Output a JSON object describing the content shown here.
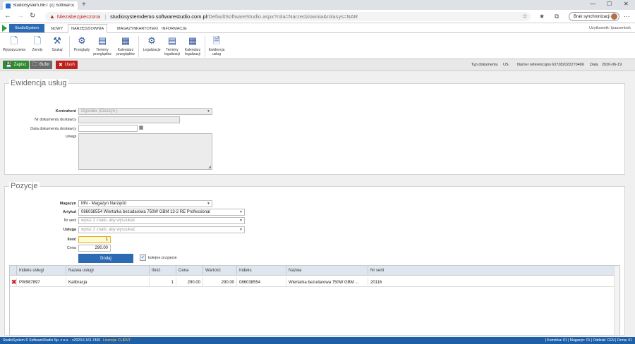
{
  "browser": {
    "tab_title": "StudioSystem.NET (c) SoftwareSt",
    "insecure_label": "Niezabezpieczona",
    "url_host": "studiosystemdemo.softwarestudio.com.pl",
    "url_path": "/DefaultSoftwareStudio.aspx?rola=Narzedziownia&rolasys=NAR",
    "sync_button": "Brak synchronizacji"
  },
  "app_menu": {
    "app_button": "StudioSystem",
    "tabs": [
      "NOWY",
      "NARZĘDZIOWNIA",
      "MAGAZYN",
      "KARTOTEKI",
      "INFORMACJE"
    ],
    "active_tab": "NARZĘDZIOWNIA",
    "logged_user": "Użytkownik: Ipaszenbek"
  },
  "ribbon": {
    "buttons": [
      "Wypożyczenia",
      "Zwroty",
      "Szukaj",
      "Przeglądy",
      "Terminy przeglądów",
      "Kalendarz przeglądów",
      "Legalizacje",
      "Terminy legalizacji",
      "Kalendarz legalizacji",
      "Ewidencja usług"
    ]
  },
  "actions": {
    "save": "Zapisz",
    "buffer": "Bufor",
    "delete": "Usuń"
  },
  "doc_info": {
    "type_label": "Typ dokumentu",
    "type_value": "US",
    "ref_label": "Numer referencyjny",
    "ref_value": "637282022270406",
    "date_label": "Data",
    "date_value": "2020-06-19"
  },
  "ewidencja": {
    "title": "Ewidencja usług",
    "kontrahent_label": "Kontrahent",
    "kontrahent_value": "Ogrodex (Cieszyn )",
    "nr_dok_label": "Nr dokumentu dostawcy",
    "nr_dok_value": "",
    "data_dok_label": "Data dokumentu dostawcy",
    "data_dok_value": "",
    "uwagi_label": "Uwagi"
  },
  "pozycje": {
    "title": "Pozycje",
    "magazyn_label": "Magazyn",
    "magazyn_value": "MN - Magazyn Narzędzi",
    "artykul_label": "Artykuł",
    "artykul_value": "086038554 Wiertarka bezudarowa 750W GBM 13-2 RE Professional",
    "nr_serii_label": "Nr serii",
    "nr_serii_placeholder": "wpisz 2 znaki, aby wyszukać",
    "usluga_label": "Usługa",
    "usluga_placeholder": "wpisz 2 znaki, aby wyszukać",
    "ilosc_label": "Ilość",
    "ilosc_value": "1",
    "cena_label": "Cena",
    "cena_value": "290.00",
    "add_button": "Dodaj",
    "kolejne_label": "kolejne przyjęcie"
  },
  "grid": {
    "columns": [
      "Indeks usługi",
      "Nazwa usługi",
      "Ilość",
      "Cena",
      "Wartość",
      "Indeks",
      "Nazwa",
      "Nr serii"
    ],
    "rows": [
      [
        "PW987897",
        "Kalibracja",
        "1",
        "290.00",
        "290.00",
        "086038554",
        "Wiertarka bezudarowa 750W GBM ...",
        "20116"
      ]
    ]
  },
  "status": {
    "left": "StudioSystem © SoftwareStudio Sp. z o.o. - v2020.6.161.7465",
    "license": "Licencja: CLIENT",
    "right": "| Komórka: 01 | Magazyn: 01 | Oddział: CEN | Firma: 01"
  },
  "colors": {
    "accent": "#2c6ab4",
    "save": "#2e8b2e",
    "buffer": "#6b6b6b",
    "delete": "#c0201c"
  }
}
